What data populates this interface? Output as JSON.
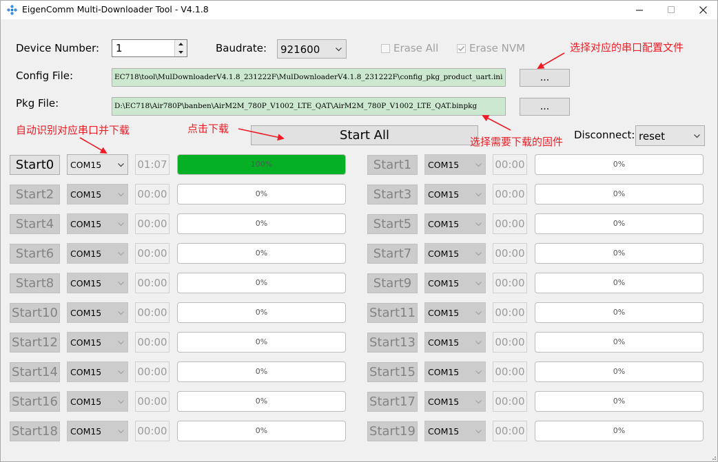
{
  "window": {
    "title": "EigenComm Multi-Downloader Tool - V4.1.8",
    "minimize_icon": "minimize-icon",
    "maximize_icon": "maximize-icon",
    "close_icon": "close-icon"
  },
  "settings": {
    "device_number_label": "Device Number:",
    "device_number_value": "1",
    "baudrate_label": "Baudrate:",
    "baudrate_value": "921600",
    "erase_all_label": "Erase All",
    "erase_all_checked": false,
    "erase_nvm_label": "Erase NVM",
    "erase_nvm_checked": true,
    "config_file_label": "Config File:",
    "config_file_value": "EC718\\tool\\MulDownloaderV4.1.8_231222F\\MulDownloaderV4.1.8_231222F\\config_pkg_product_uart.ini",
    "pkg_file_label": "Pkg File:",
    "pkg_file_value": "D:\\EC718\\Air780P\\banben\\AirM2M_780P_V1002_LTE_QAT\\AirM2M_780P_V1002_LTE_QAT.binpkg",
    "browse_label": "...",
    "start_all_label": "Start All",
    "disconnect_label": "Disconnect:",
    "disconnect_value": "reset"
  },
  "annotations": {
    "select_config": "选择对应的串口配置文件",
    "auto_detect": "自动识别对应串口并下载",
    "click_download": "点击下载",
    "select_firmware": "选择需要下载的固件"
  },
  "colors": {
    "annotation": "#ee1c25",
    "progress_fill": "#06b025",
    "path_bg": "#cce8cf"
  },
  "ports": [
    {
      "label": "Start0",
      "com": "COM15",
      "time": "01:07",
      "progress_text": "100%",
      "progress": 1.0,
      "enabled": true
    },
    {
      "label": "Start1",
      "com": "COM15",
      "time": "00:00",
      "progress_text": "0%",
      "progress": 0,
      "enabled": false
    },
    {
      "label": "Start2",
      "com": "COM15",
      "time": "00:00",
      "progress_text": "0%",
      "progress": 0,
      "enabled": false
    },
    {
      "label": "Start3",
      "com": "COM15",
      "time": "00:00",
      "progress_text": "0%",
      "progress": 0,
      "enabled": false
    },
    {
      "label": "Start4",
      "com": "COM15",
      "time": "00:00",
      "progress_text": "0%",
      "progress": 0,
      "enabled": false
    },
    {
      "label": "Start5",
      "com": "COM15",
      "time": "00:00",
      "progress_text": "0%",
      "progress": 0,
      "enabled": false
    },
    {
      "label": "Start6",
      "com": "COM15",
      "time": "00:00",
      "progress_text": "0%",
      "progress": 0,
      "enabled": false
    },
    {
      "label": "Start7",
      "com": "COM15",
      "time": "00:00",
      "progress_text": "0%",
      "progress": 0,
      "enabled": false
    },
    {
      "label": "Start8",
      "com": "COM15",
      "time": "00:00",
      "progress_text": "0%",
      "progress": 0,
      "enabled": false
    },
    {
      "label": "Start9",
      "com": "COM15",
      "time": "00:00",
      "progress_text": "0%",
      "progress": 0,
      "enabled": false
    },
    {
      "label": "Start10",
      "com": "COM15",
      "time": "00:00",
      "progress_text": "0%",
      "progress": 0,
      "enabled": false
    },
    {
      "label": "Start11",
      "com": "COM15",
      "time": "00:00",
      "progress_text": "0%",
      "progress": 0,
      "enabled": false
    },
    {
      "label": "Start12",
      "com": "COM15",
      "time": "00:00",
      "progress_text": "0%",
      "progress": 0,
      "enabled": false
    },
    {
      "label": "Start13",
      "com": "COM15",
      "time": "00:00",
      "progress_text": "0%",
      "progress": 0,
      "enabled": false
    },
    {
      "label": "Start14",
      "com": "COM15",
      "time": "00:00",
      "progress_text": "0%",
      "progress": 0,
      "enabled": false
    },
    {
      "label": "Start15",
      "com": "COM15",
      "time": "00:00",
      "progress_text": "0%",
      "progress": 0,
      "enabled": false
    },
    {
      "label": "Start16",
      "com": "COM15",
      "time": "00:00",
      "progress_text": "0%",
      "progress": 0,
      "enabled": false
    },
    {
      "label": "Start17",
      "com": "COM15",
      "time": "00:00",
      "progress_text": "0%",
      "progress": 0,
      "enabled": false
    },
    {
      "label": "Start18",
      "com": "COM15",
      "time": "00:00",
      "progress_text": "0%",
      "progress": 0,
      "enabled": false
    },
    {
      "label": "Start19",
      "com": "COM15",
      "time": "00:00",
      "progress_text": "0%",
      "progress": 0,
      "enabled": false
    }
  ]
}
